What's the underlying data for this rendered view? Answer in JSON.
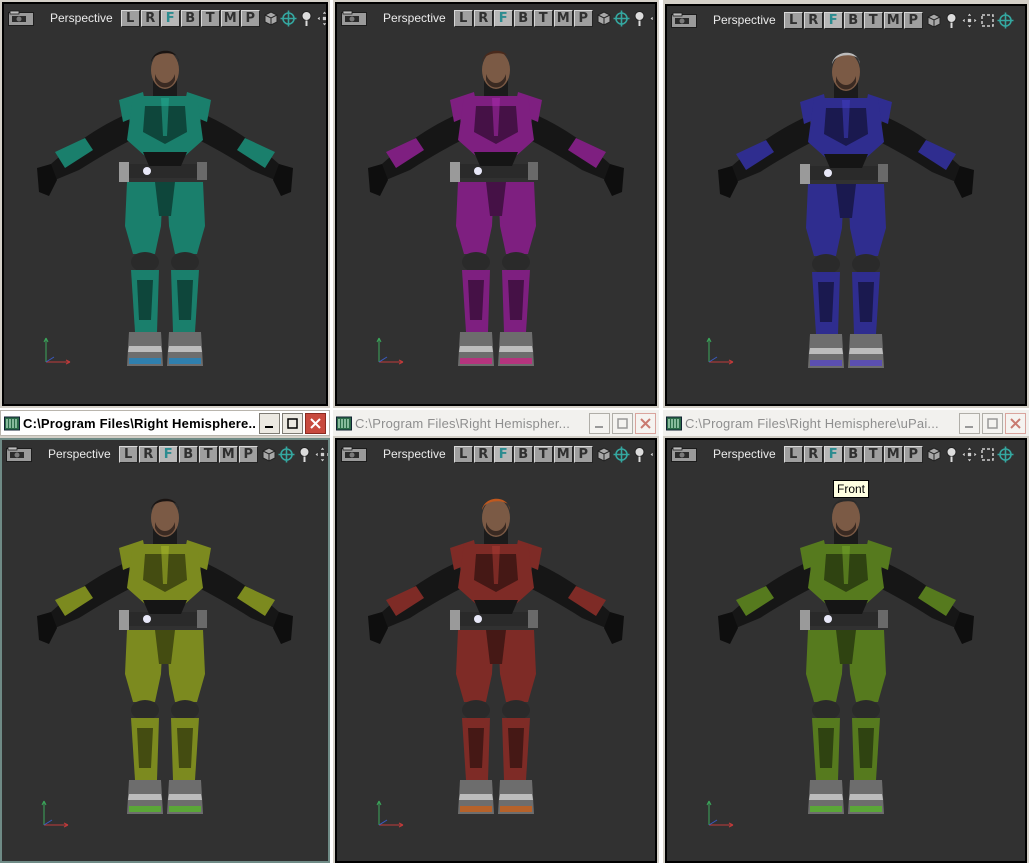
{
  "windows": [
    {
      "title": "",
      "active": false,
      "camera_label": "Perspective",
      "view_buttons": [
        "L",
        "R",
        "F",
        "B",
        "T",
        "M",
        "P"
      ],
      "active_view": "F",
      "armor_color": "#1a7f6c",
      "hair": "#1a1412",
      "shoe_light": "#2f7fae"
    },
    {
      "title": "",
      "active": false,
      "camera_label": "Perspective",
      "view_buttons": [
        "L",
        "R",
        "F",
        "B",
        "T",
        "M",
        "P"
      ],
      "active_view": "F",
      "armor_color": "#7e1f80",
      "hair": "#4a2a1c",
      "shoe_light": "#b5347e"
    },
    {
      "title": "",
      "active": false,
      "camera_label": "Perspective",
      "view_buttons": [
        "L",
        "R",
        "F",
        "B",
        "T",
        "M",
        "P"
      ],
      "active_view": "F",
      "armor_color": "#2f2d8f",
      "hair": "#bcbcbc",
      "shoe_light": "#5b4fb0"
    },
    {
      "title": "C:\\Program Files\\Right Hemisphere...",
      "active": true,
      "camera_label": "Perspective",
      "view_buttons": [
        "L",
        "R",
        "F",
        "B",
        "T",
        "M",
        "P"
      ],
      "active_view": "F",
      "armor_color": "#7c8a1f",
      "hair": "#1a1412",
      "shoe_light": "#5ba638"
    },
    {
      "title": "C:\\Program Files\\Right Hemispher...",
      "active": false,
      "camera_label": "Perspective",
      "view_buttons": [
        "L",
        "R",
        "F",
        "B",
        "T",
        "M",
        "P"
      ],
      "active_view": "F",
      "armor_color": "#7e2b26",
      "hair": "#c0581e",
      "shoe_light": "#b6622a"
    },
    {
      "title": "C:\\Program Files\\Right Hemisphere\\uPai...",
      "active": false,
      "camera_label": "Perspective",
      "view_buttons": [
        "L",
        "R",
        "F",
        "B",
        "T",
        "M",
        "P"
      ],
      "active_view": "F",
      "armor_color": "#567a1e",
      "hair": "#2a2a2a",
      "shoe_light": "#5ba638"
    }
  ],
  "tooltip": "Front",
  "icons": {
    "app": "maze-app-icon",
    "camera": "camera-icon",
    "tools": [
      "cube-view-icon",
      "orbit-icon",
      "zoom-icon",
      "pan-icon"
    ],
    "extra_tools": [
      "fit-icon"
    ],
    "window_buttons": [
      "minimize-icon",
      "maximize-icon",
      "close-icon"
    ]
  }
}
